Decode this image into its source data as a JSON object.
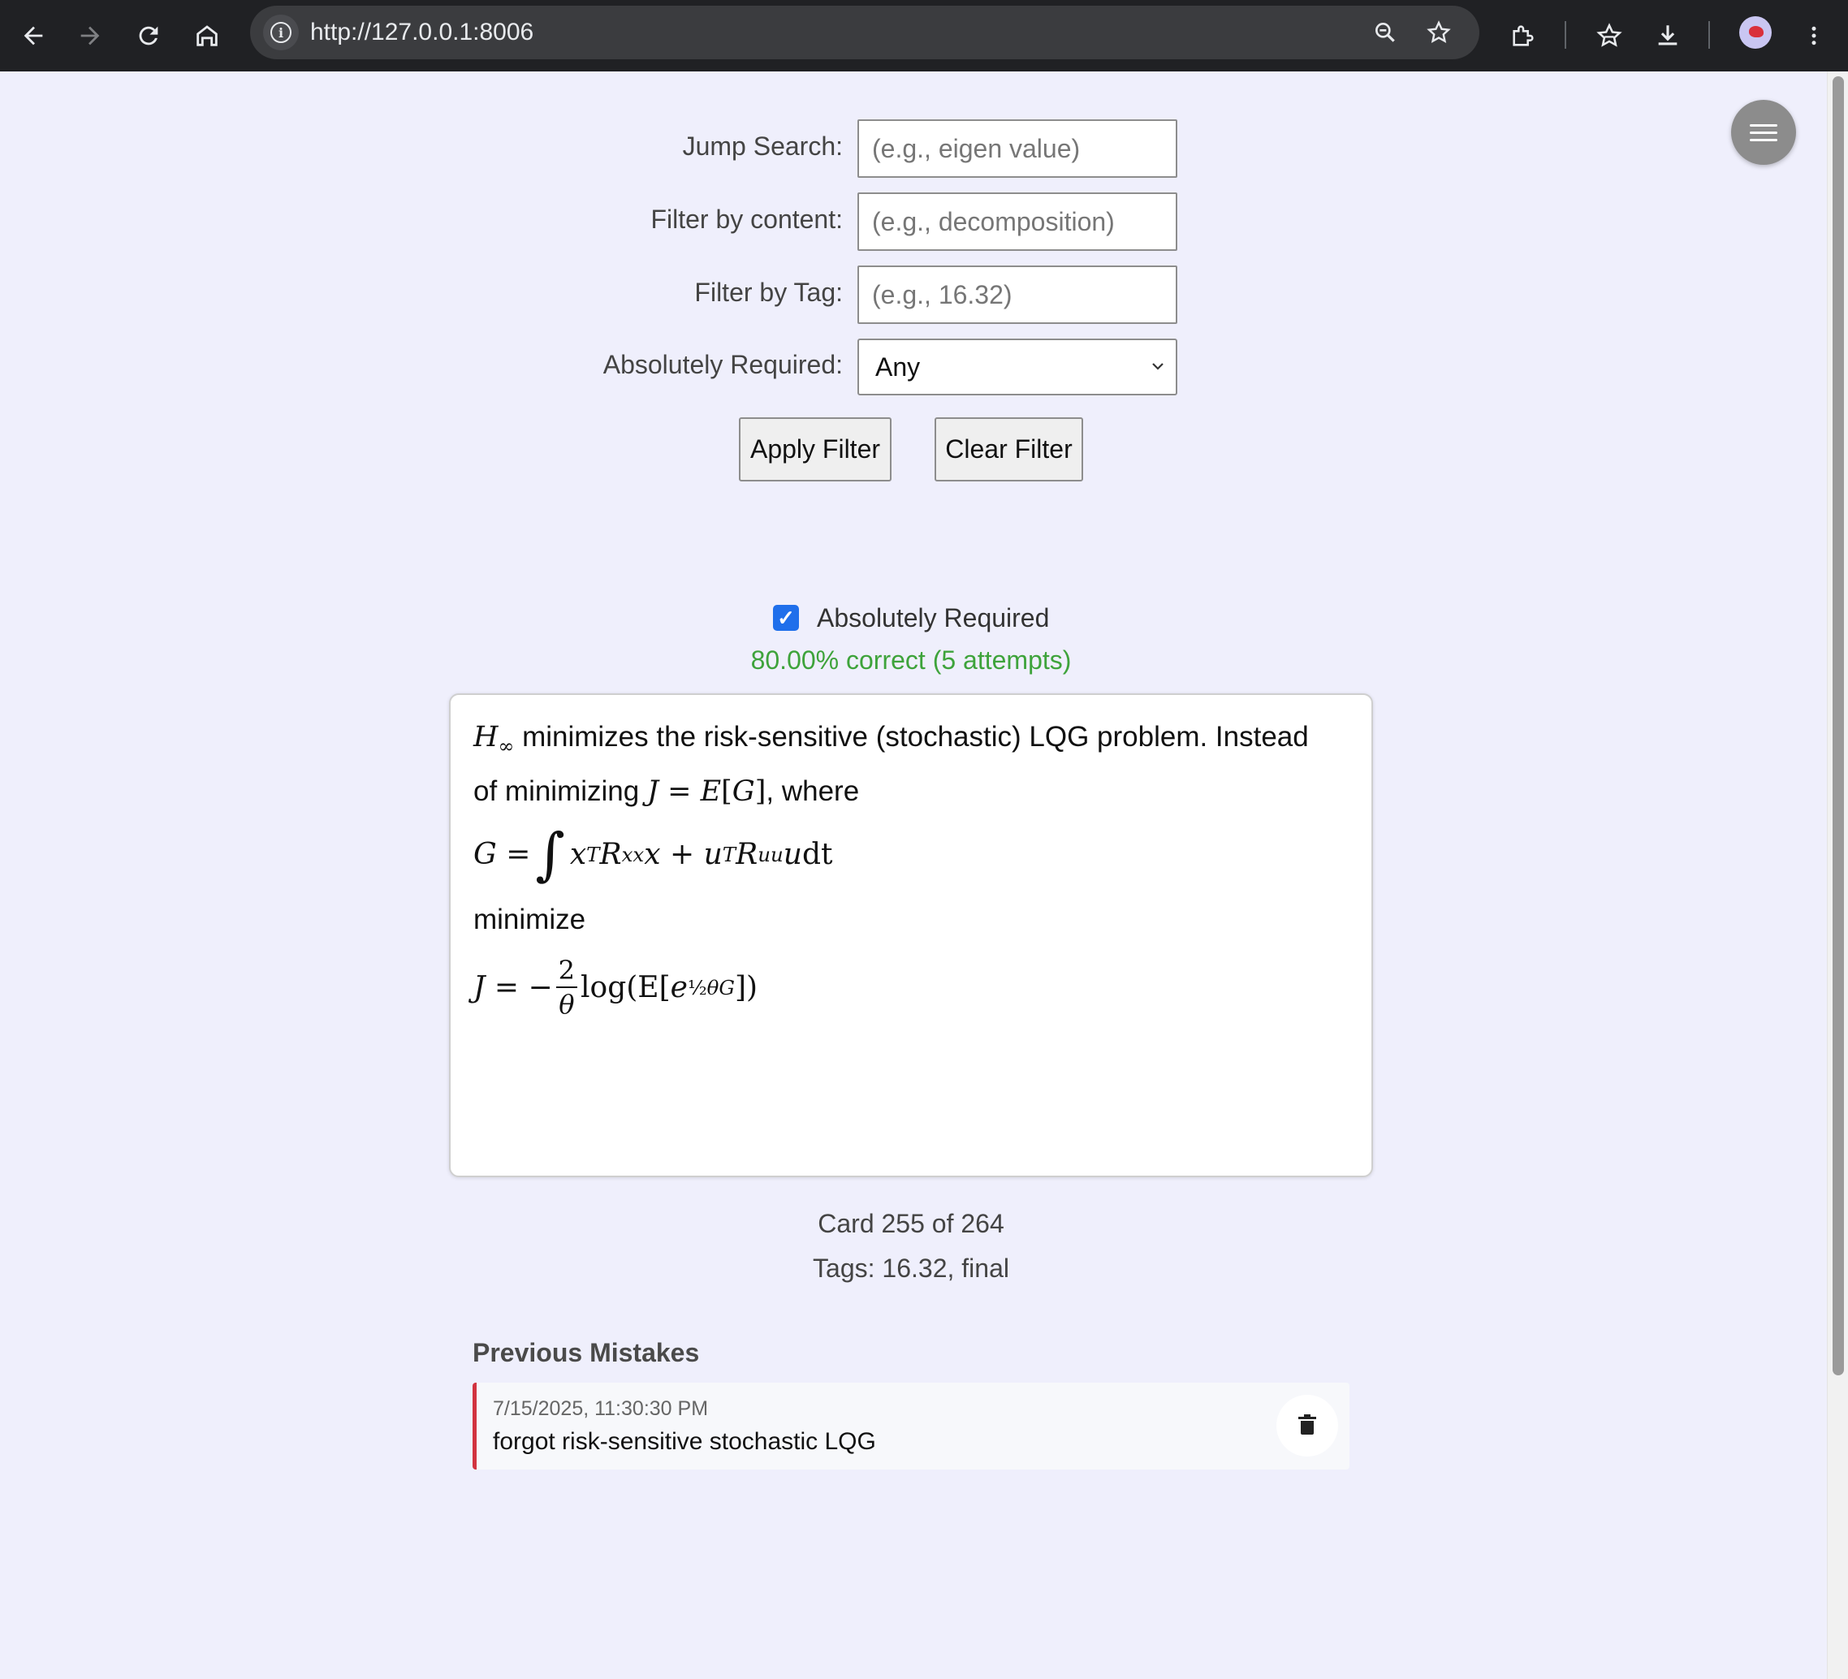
{
  "browser": {
    "url": "http://127.0.0.1:8006",
    "icons": {
      "back": "arrow-left-icon",
      "forward": "arrow-right-icon",
      "reload": "reload-icon",
      "home": "home-icon",
      "site_info": "info-icon",
      "zoom": "zoom-icon",
      "bookmark": "star-icon",
      "extensions": "puzzle-icon",
      "bookmarks": "bookmarks-icon",
      "downloads": "download-icon",
      "menu": "kebab-menu-icon"
    }
  },
  "filters": {
    "jump_search": {
      "label": "Jump Search:",
      "placeholder": "(e.g., eigen value)",
      "value": ""
    },
    "content": {
      "label": "Filter by content:",
      "placeholder": "(e.g., decomposition)",
      "value": ""
    },
    "tag": {
      "label": "Filter by Tag:",
      "placeholder": "(e.g., 16.32)",
      "value": ""
    },
    "required": {
      "label": "Absolutely Required:",
      "selected": "Any"
    },
    "apply_label": "Apply Filter",
    "clear_label": "Clear Filter"
  },
  "card": {
    "required_checked": true,
    "required_label": "Absolutely Required",
    "score_text": "80.00% correct (5 attempts)",
    "score_color": "#3ea33b",
    "text_line1": " minimizes the risk-sensitive (stochastic) LQG problem. Instead",
    "text_line2_prefix": "of minimizing ",
    "text_line2_suffix": ", where",
    "word_minimize": "minimize",
    "counter": "Card 255 of 264",
    "tags": "Tags: 16.32, final"
  },
  "mistakes": {
    "title": "Previous Mistakes",
    "items": [
      {
        "date": "7/15/2025, 11:30:30 PM",
        "text": "forgot risk-sensitive stochastic LQG"
      }
    ],
    "accent_color": "#d2333f"
  },
  "colors": {
    "page_bg": "#efeffc",
    "chrome_bg": "#202124",
    "checkbox": "#1f6feb"
  }
}
